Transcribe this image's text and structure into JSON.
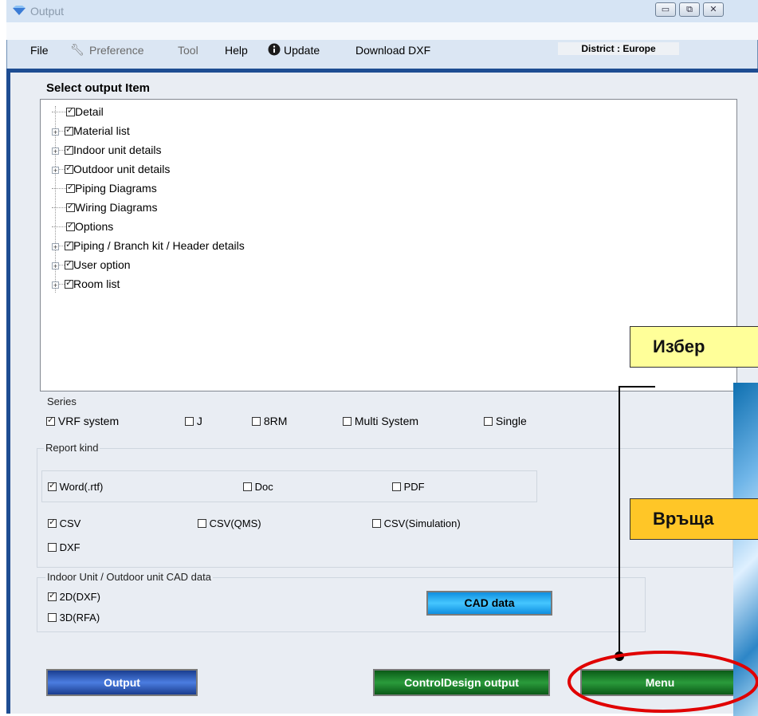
{
  "window": {
    "title": "Output",
    "minimize_label": "▭",
    "restore_label": "⧉",
    "close_label": "✕"
  },
  "menu": {
    "file": "File",
    "preference": "Preference",
    "tool": "Tool",
    "help": "Help",
    "update": "Update",
    "download_dxf": "Download DXF",
    "district": "District : Europe"
  },
  "select_output": {
    "heading": "Select output Item",
    "items": [
      {
        "label": "Detail",
        "checked": true,
        "expandable": false
      },
      {
        "label": "Material list",
        "checked": true,
        "expandable": true
      },
      {
        "label": "Indoor unit details",
        "checked": true,
        "expandable": true
      },
      {
        "label": "Outdoor unit details",
        "checked": true,
        "expandable": true
      },
      {
        "label": "Piping Diagrams",
        "checked": true,
        "expandable": false
      },
      {
        "label": "Wiring Diagrams",
        "checked": true,
        "expandable": false
      },
      {
        "label": "Options",
        "checked": true,
        "expandable": false
      },
      {
        "label": "Piping / Branch kit / Header details",
        "checked": true,
        "expandable": true
      },
      {
        "label": "User option",
        "checked": true,
        "expandable": true
      },
      {
        "label": "Room list",
        "checked": true,
        "expandable": true
      }
    ]
  },
  "series": {
    "label": "Series",
    "options": [
      {
        "label": "VRF system",
        "checked": true
      },
      {
        "label": "J",
        "checked": false
      },
      {
        "label": "8RM",
        "checked": false
      },
      {
        "label": "Multi System",
        "checked": false
      },
      {
        "label": "Single",
        "checked": false
      }
    ]
  },
  "report_kind": {
    "label": "Report kind",
    "word": {
      "label": "Word(.rtf)",
      "checked": true
    },
    "doc": {
      "label": "Doc",
      "checked": false
    },
    "pdf": {
      "label": "PDF",
      "checked": false
    },
    "csv": {
      "label": "CSV",
      "checked": true
    },
    "csv_qms": {
      "label": "CSV(QMS)",
      "checked": false
    },
    "csv_sim": {
      "label": "CSV(Simulation)",
      "checked": false
    },
    "dxf": {
      "label": "DXF",
      "checked": false
    }
  },
  "cad": {
    "label": "Indoor Unit / Outdoor unit CAD data",
    "dxf2d": {
      "label": "2D(DXF)",
      "checked": true
    },
    "rfa3d": {
      "label": "3D(RFA)",
      "checked": false
    },
    "button": "CAD data"
  },
  "buttons": {
    "output": "Output",
    "control_design": "ControlDesign output",
    "menu": "Menu"
  },
  "callouts": {
    "select": "Избер",
    "return": "Връща"
  },
  "colors": {
    "frame": "#1e4d92",
    "callout_yellow": "#ffff99",
    "callout_orange": "#ffc627",
    "highlight_ring": "#e00000"
  }
}
